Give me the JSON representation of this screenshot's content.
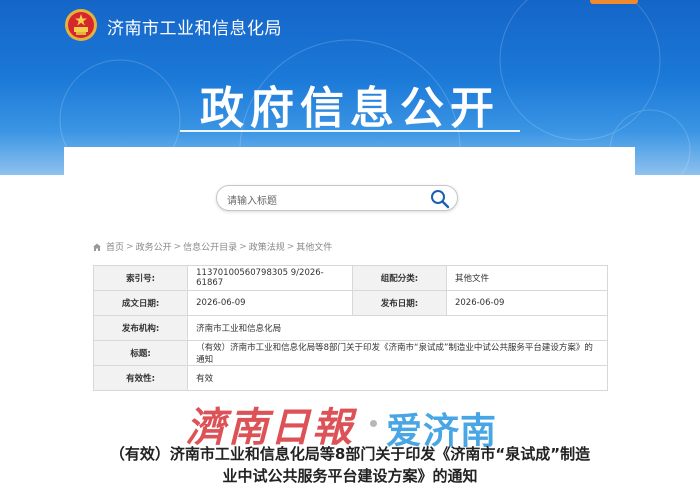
{
  "header": {
    "site_name": "济南市工业和信息化局",
    "banner_title": "政府信息公开"
  },
  "search": {
    "placeholder": "请输入标题"
  },
  "breadcrumb": [
    "首页",
    "政务公开",
    "信息公开目录",
    "政策法规",
    "其他文件"
  ],
  "info_table": {
    "index_label": "索引号:",
    "index_value": "11370100560798305 9/2026-61867",
    "category_label": "组配分类:",
    "category_value": "其他文件",
    "date_label": "成文日期:",
    "date_value": "2026-06-09",
    "publish_label": "发布日期:",
    "publish_value": "2026-06-09",
    "org_label": "发布机构:",
    "org_value": "济南市工业和信息化局",
    "title_label": "标题:",
    "title_value": "（有效）济南市工业和信息化局等8部门关于印发《济南市“泉试成”制造业中试公共服务平台建设方案》的通知",
    "validity_label": "有效性:",
    "validity_value": "有效"
  },
  "document": {
    "title_line1": "（有效）济南市工业和信息化局等8部门关于印发《济南市“泉试成”制造",
    "title_line2": "业中试公共服务平台建设方案》的通知"
  },
  "watermark": {
    "text_red": "濟南日報",
    "text_blue": "爱济南"
  },
  "colors": {
    "banner_blue": "#1b79d8",
    "accent_orange": "#f08a2c",
    "label_bg": "#f2f2f2"
  }
}
